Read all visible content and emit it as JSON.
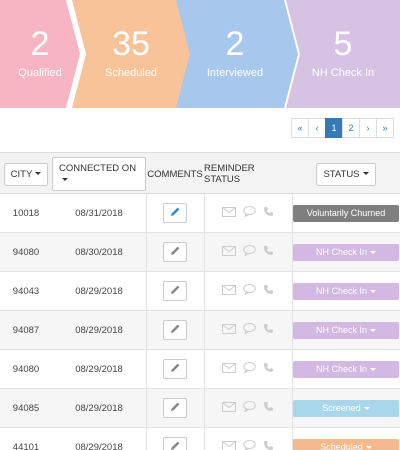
{
  "funnel": [
    {
      "count": "2",
      "label": "Qualified",
      "color": "#f7b5c3"
    },
    {
      "count": "35",
      "label": "Scheduled",
      "color": "#f8c399"
    },
    {
      "count": "2",
      "label": "Interviewed",
      "color": "#a7c7ec"
    },
    {
      "count": "5",
      "label": "NH Check In",
      "color": "#d6c2e2"
    }
  ],
  "expand_icon": "collapse-arrows-icon",
  "pagination": {
    "first": "«",
    "prev": "‹",
    "pages": [
      "1",
      "2"
    ],
    "active_page": "1",
    "next": "›",
    "last": "»"
  },
  "table": {
    "headers": {
      "city": "CITY",
      "connected_on": "CONNECTED ON",
      "comments": "COMMENTS",
      "reminder_status": "REMINDER STATUS",
      "status": "STATUS"
    },
    "rows": [
      {
        "city": "10018",
        "connected_on": "08/31/2018",
        "status": "Voluntarily Churned",
        "status_color": "#7f7f7f",
        "edit_active": true
      },
      {
        "city": "94080",
        "connected_on": "08/30/2018",
        "status": "NH Check In",
        "status_color": "#d3b8e3",
        "edit_active": false
      },
      {
        "city": "94043",
        "connected_on": "08/29/2018",
        "status": "NH Check In",
        "status_color": "#d3b8e3",
        "edit_active": false
      },
      {
        "city": "94087",
        "connected_on": "08/29/2018",
        "status": "NH Check In",
        "status_color": "#d3b8e3",
        "edit_active": false
      },
      {
        "city": "94080",
        "connected_on": "08/29/2018",
        "status": "NH Check In",
        "status_color": "#d3b8e3",
        "edit_active": false
      },
      {
        "city": "94085",
        "connected_on": "08/29/2018",
        "status": "Screened",
        "status_color": "#a8d6ea",
        "edit_active": false
      },
      {
        "city": "44101",
        "connected_on": "08/29/2018",
        "status": "Scheduled",
        "status_color": "#f4b98c",
        "edit_active": false
      }
    ]
  }
}
